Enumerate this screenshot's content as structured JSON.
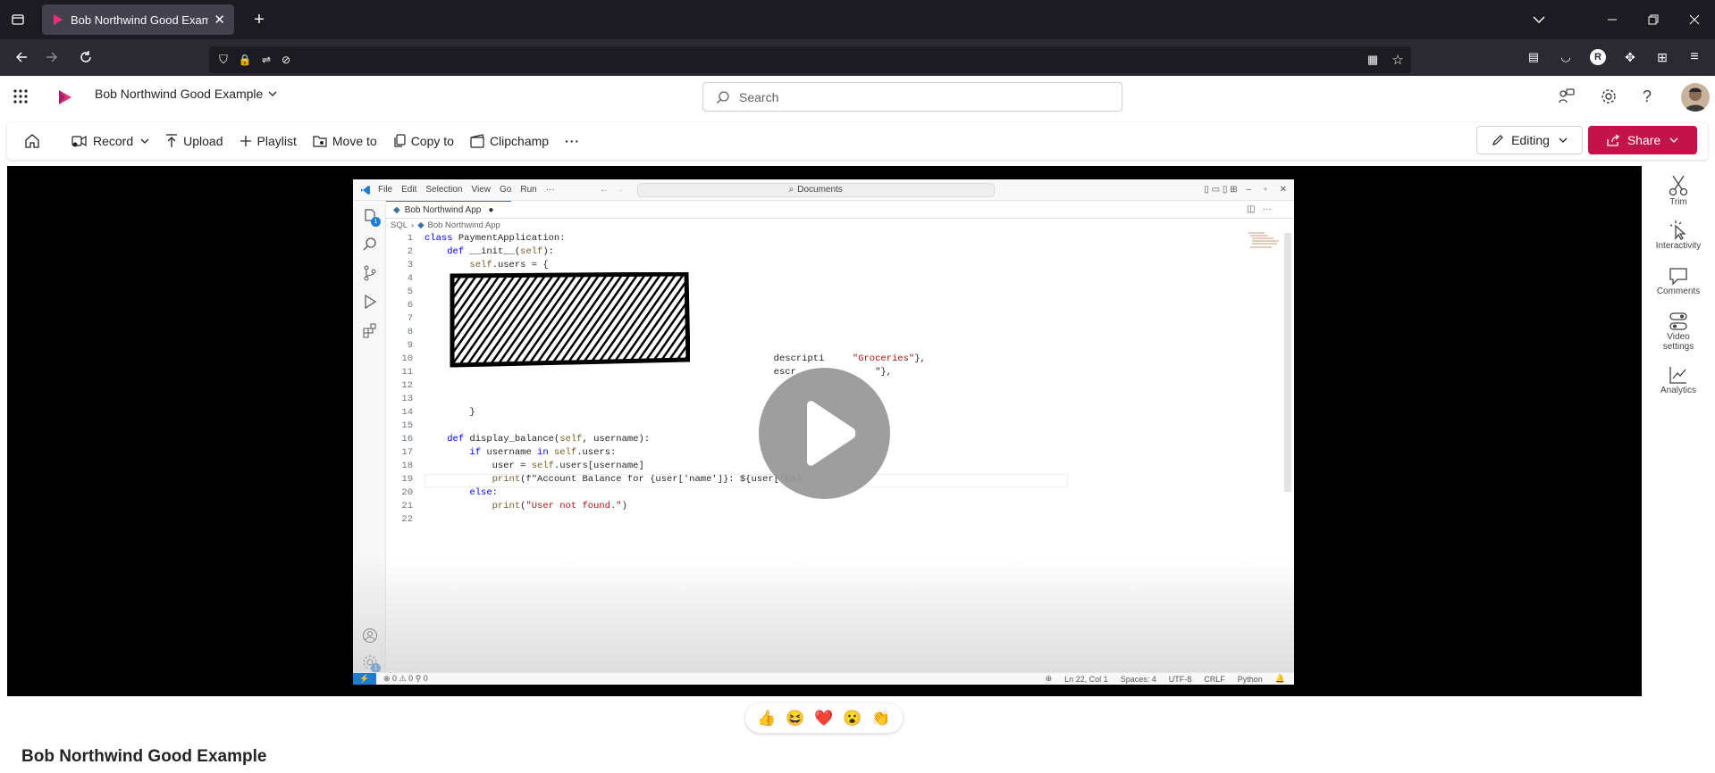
{
  "browser": {
    "tab_title": "Bob Northwind Good Example",
    "new_tab": "+",
    "url": ""
  },
  "app": {
    "title": "Bob Northwind Good Example",
    "search_placeholder": "Search"
  },
  "toolbar": {
    "record": "Record",
    "upload": "Upload",
    "playlist": "Playlist",
    "move_to": "Move to",
    "copy_to": "Copy to",
    "clipchamp": "Clipchamp",
    "more": "···",
    "editing": "Editing",
    "share": "Share"
  },
  "rail": {
    "trim": "Trim",
    "interactivity": "Interactivity",
    "comments": "Comments",
    "video_settings": "Video settings",
    "analytics": "Analytics"
  },
  "vscode": {
    "menu": [
      "File",
      "Edit",
      "Selection",
      "View",
      "Go",
      "Run",
      "···"
    ],
    "command_center": "Documents",
    "tab": "Bob Northwind App",
    "breadcrumb_root": "SQL",
    "breadcrumb_file": "Bob Northwind App",
    "code_lines": [
      "class PaymentApplication:",
      "    def __init__(self):",
      "        self.users = {",
      "",
      "",
      "",
      "",
      "",
      "",
      "                                                              descripti     \"Groceries\"},",
      "                                                              escr              \"},",
      "",
      "",
      "        }",
      "",
      "    def display_balance(self, username):",
      "        if username in self.users:",
      "            user = self.users[username]",
      "            print(f\"Account Balance for {user['name']}: ${user['bal",
      "        else:",
      "            print(\"User not found.\")",
      ""
    ],
    "status_left": "⊗ 0 ⚠ 0   ⚲ 0",
    "status_right": [
      "Ln 22, Col 1",
      "Spaces: 4",
      "UTF-8",
      "CRLF",
      "Python"
    ],
    "badge": "1"
  },
  "reactions": [
    "👍",
    "😆",
    "❤️",
    "😮",
    "👏"
  ],
  "video_title": "Bob Northwind Good Example"
}
